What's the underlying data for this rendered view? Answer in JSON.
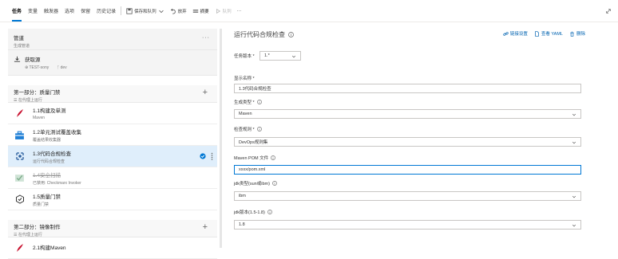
{
  "topbar": {
    "tabs": [
      "任务",
      "变量",
      "触发器",
      "选项",
      "保留",
      "历史记录"
    ],
    "save_queue": "保存和队列",
    "discard": "放弃",
    "summary": "摘要",
    "queue": "队列",
    "more": "···"
  },
  "left": {
    "pipeline": {
      "title": "管道",
      "subtitle": "生成管道",
      "more": "···"
    },
    "get_sources": {
      "title": "获取源",
      "repo": "TEST-sony",
      "branch": "dev"
    },
    "phases": [
      {
        "title": "第一部分：质量门禁",
        "subtitle": "在代理上运行",
        "tasks": [
          {
            "title": "1.1构建及单测",
            "subtitle": "Maven",
            "icon": "maven-feather-icon",
            "state": "normal"
          },
          {
            "title": "1.2单元测试覆盖收集",
            "subtitle": "覆盖结果收集器",
            "icon": "toolbox-icon",
            "state": "normal"
          },
          {
            "title": "1.3代码合规检查",
            "subtitle": "运行代码合规检查",
            "icon": "code-check-icon",
            "state": "selected"
          },
          {
            "title": "1.4安全扫描",
            "subtitle": "已禁用: Checkmarx Invoker",
            "icon": "security-scan-icon",
            "state": "disabled"
          },
          {
            "title": "1.5质量门禁",
            "subtitle": "质量门禁",
            "icon": "quality-gate-icon",
            "state": "normal"
          }
        ]
      },
      {
        "title": "第二部分：镜像制作",
        "subtitle": "在代理上运行",
        "tasks": [
          {
            "title": "2.1构建Maven",
            "subtitle": "",
            "icon": "maven-feather-icon",
            "state": "normal"
          }
        ]
      }
    ]
  },
  "right": {
    "title": "运行代码合规检查",
    "links": {
      "link_settings": "链接设置",
      "view_yaml": "查看 YAML",
      "remove": "删除"
    },
    "task_version_label": "任务版本 *",
    "task_version": "1.*",
    "display_name_label": "显示名称 *",
    "display_name": "1.3代码合规检查",
    "build_type_label": "生成类型 *",
    "build_type": "Maven",
    "ruleset_label": "检查规则 *",
    "ruleset": "DevOps规则集",
    "pom_label": "Maven POM 文件",
    "pom_value": "xxxx/pom.xml",
    "jdk_type_label": "jdk类型(sun或ibm)",
    "jdk_type": "ibm",
    "jdk_version_label": "jdk版本(1.5-1.8)",
    "jdk_version": "1.8"
  },
  "colors": {
    "accent": "#0078d4",
    "selected_bg": "#dfeefb",
    "panel_bg": "#f4f4f4"
  }
}
